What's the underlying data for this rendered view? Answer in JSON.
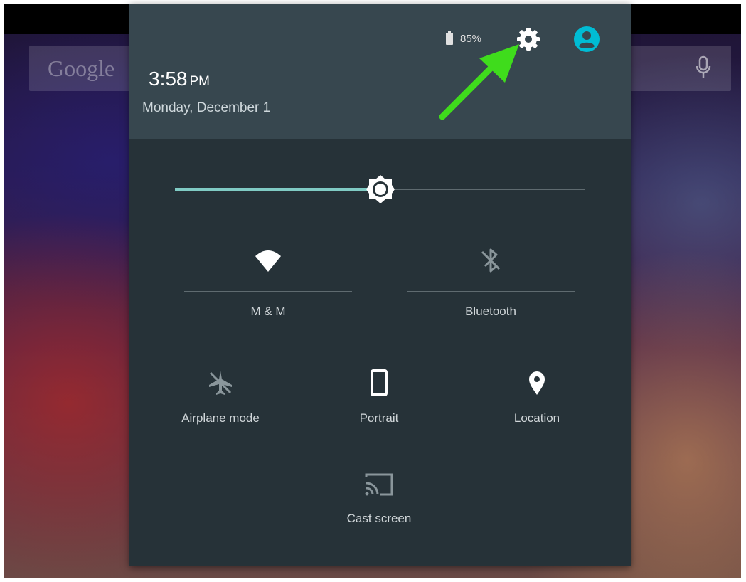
{
  "home": {
    "search_logo": "Google"
  },
  "header": {
    "time": "3:58",
    "ampm": "PM",
    "date": "Monday, December 1",
    "battery": "85%"
  },
  "brightness": {
    "level": 0.5
  },
  "tiles": {
    "wifi": {
      "label": "M & M",
      "icon": "wifi-icon"
    },
    "bluetooth": {
      "label": "Bluetooth",
      "icon": "bluetooth-disabled-icon"
    },
    "airplane": {
      "label": "Airplane mode",
      "icon": "airplane-off-icon"
    },
    "rotation": {
      "label": "Portrait",
      "icon": "portrait-icon"
    },
    "location": {
      "label": "Location",
      "icon": "location-pin-icon"
    },
    "cast": {
      "label": "Cast screen",
      "icon": "cast-icon"
    }
  },
  "colors": {
    "header_bg": "#37474f",
    "panel_bg": "#263238",
    "accent": "#80cbc4",
    "avatar": "#00bcd4",
    "arrow": "#3fdc1c"
  }
}
